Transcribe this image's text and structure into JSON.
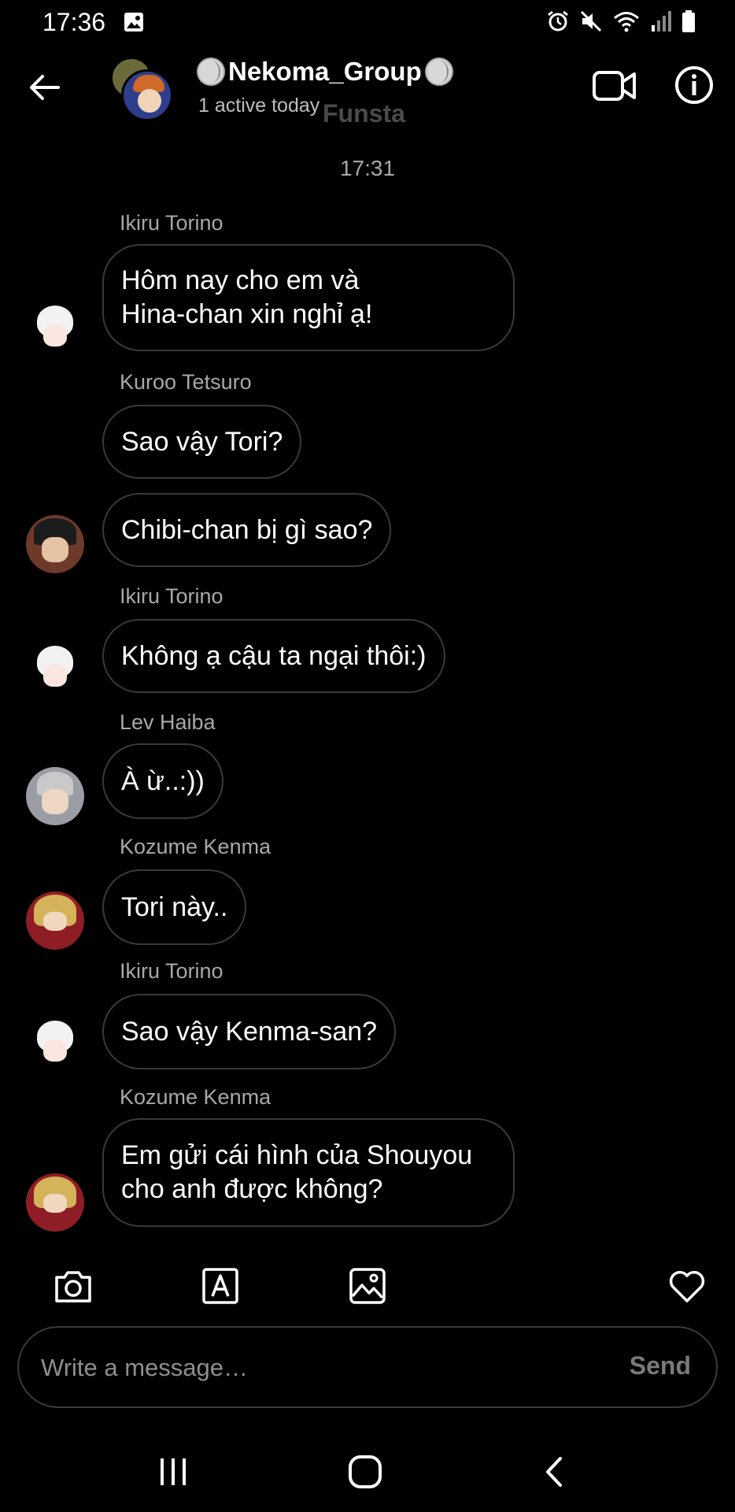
{
  "status_bar": {
    "time": "17:36",
    "icons": [
      "image-icon",
      "alarm-icon",
      "mute-icon",
      "wifi-icon",
      "signal-icon",
      "battery-icon"
    ]
  },
  "header": {
    "title": "Nekoma_Group",
    "title_decoration": "volleyball-icon",
    "subtitle": "1 active today",
    "watermark": "Funsta"
  },
  "conversation": {
    "timestamp": "17:31",
    "messages": [
      {
        "sender": "Ikiru Torino",
        "lines": [
          "Hôm nay cho em và",
          "Hina-chan xin nghỉ ạ!"
        ]
      },
      {
        "sender": "Kuroo Tetsuro",
        "lines": [
          "Sao vậy Tori?"
        ]
      },
      {
        "sender": "",
        "lines": [
          "Chibi-chan bị gì sao?"
        ]
      },
      {
        "sender": "Ikiru Torino",
        "lines": [
          "Không ạ cậu ta ngại thôi:)"
        ]
      },
      {
        "sender": "Lev Haiba",
        "lines": [
          "À ừ..:))"
        ]
      },
      {
        "sender": "Kozume Kenma",
        "lines": [
          "Tori này.."
        ]
      },
      {
        "sender": "Ikiru Torino",
        "lines": [
          "Sao vậy Kenma-san?"
        ]
      },
      {
        "sender": "Kozume Kenma",
        "lines": [
          "Em gửi cái hình của Shouyou",
          "cho anh được không?"
        ]
      }
    ]
  },
  "composer": {
    "placeholder": "Write a message…",
    "value": "",
    "send_label": "Send"
  },
  "colors": {
    "background": "#000000",
    "bubble_border": "#3a3a3a",
    "secondary_text": "#a8a8a8",
    "send_disabled": "#7a7a7a"
  }
}
